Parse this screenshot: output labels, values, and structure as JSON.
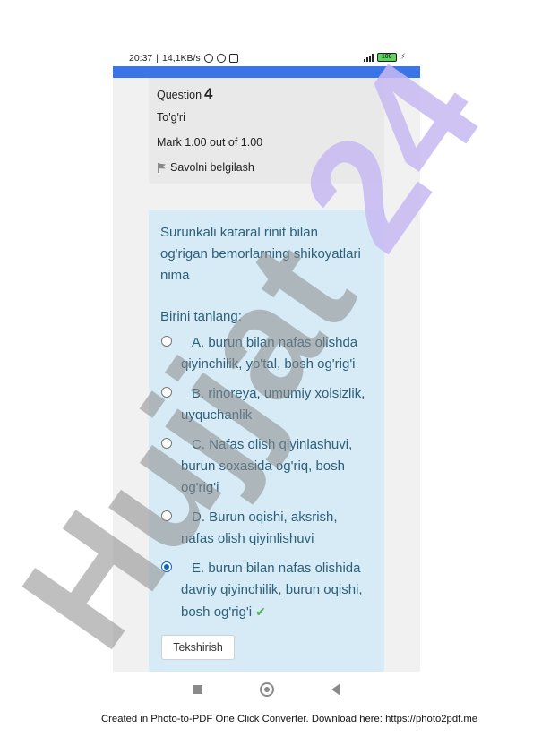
{
  "status": {
    "time": "20:37",
    "speed": "14,1KB/s",
    "battery": "100"
  },
  "question": {
    "label": "Question",
    "number": "4",
    "state": "To'g'ri",
    "mark": "Mark 1.00 out of 1.00",
    "flag_label": "Savolni belgilash",
    "text": "Surunkali kataral rinit bilan og'rigan bemorlarning shikoyatlari nima",
    "prompt": "Birini tanlang:",
    "options": [
      {
        "text": "A. burun bilan nafas olishda qiyinchilik, yo'tal, bosh og'rig'i",
        "checked": false
      },
      {
        "text": "B. rinoreya, umumiy xolsizlik, uyquchanlik",
        "checked": false
      },
      {
        "text": "C. Nafas olish qiyinlashuvi, burun soxasida og'riq, bosh og'rig'i",
        "checked": false
      },
      {
        "text": "D. Burun oqishi, aksrish, nafas olish qiyinlishuvi",
        "checked": false
      },
      {
        "text": "E. burun bilan nafas olishida davriy qiyinchilik, burun oqishi, bosh og'rig'i",
        "checked": true
      }
    ],
    "check_button": "Tekshirish"
  },
  "watermark": {
    "text": "Hujjat 24"
  },
  "footer": {
    "text": "Created in Photo-to-PDF One Click Converter. Download here: https://photo2pdf.me"
  },
  "colors": {
    "accent_bar": "#3b74e6",
    "question_bg": "#d6ebf6",
    "question_text": "#2d5f7a",
    "correct_check": "#4caf50"
  }
}
